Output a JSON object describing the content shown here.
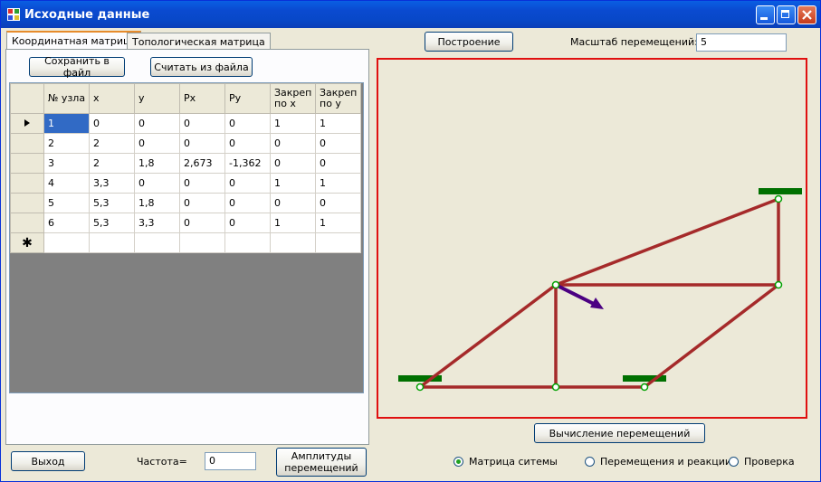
{
  "window": {
    "title": "Исходные данные"
  },
  "tabs": [
    {
      "label": "Координатная матрица"
    },
    {
      "label": "Топологическая матрица"
    }
  ],
  "buttons": {
    "save_file": "Сохранить в файл",
    "load_file": "Считать из файла",
    "build": "Построение",
    "compute": "Вычисление перемещений",
    "exit": "Выход",
    "amplitudes": "Амплитуды перемещений"
  },
  "scale": {
    "label": "Масштаб перемещений:",
    "value": "5"
  },
  "frequency": {
    "label": "Частота=",
    "value": "0"
  },
  "table": {
    "columns": [
      "№ узла",
      "x",
      "y",
      "Px",
      "Py",
      "Закреп по x",
      "Закреп по y"
    ],
    "rows": [
      [
        "1",
        "0",
        "0",
        "0",
        "0",
        "1",
        "1"
      ],
      [
        "2",
        "2",
        "0",
        "0",
        "0",
        "0",
        "0"
      ],
      [
        "3",
        "2",
        "1,8",
        "2,673",
        "-1,362",
        "0",
        "0"
      ],
      [
        "4",
        "3,3",
        "0",
        "0",
        "0",
        "1",
        "1"
      ],
      [
        "5",
        "5,3",
        "1,8",
        "0",
        "0",
        "0",
        "0"
      ],
      [
        "6",
        "5,3",
        "3,3",
        "0",
        "0",
        "1",
        "1"
      ]
    ]
  },
  "radios": [
    {
      "label": "Матрица ситемы",
      "checked": true
    },
    {
      "label": "Перемещения и реакции",
      "checked": false
    },
    {
      "label": "Проверка",
      "checked": false
    }
  ],
  "colors": {
    "member": "#a52a2a",
    "support": "#007000",
    "load_arrow": "#4b0082",
    "node": "#00a000",
    "frame": "#e01010"
  }
}
